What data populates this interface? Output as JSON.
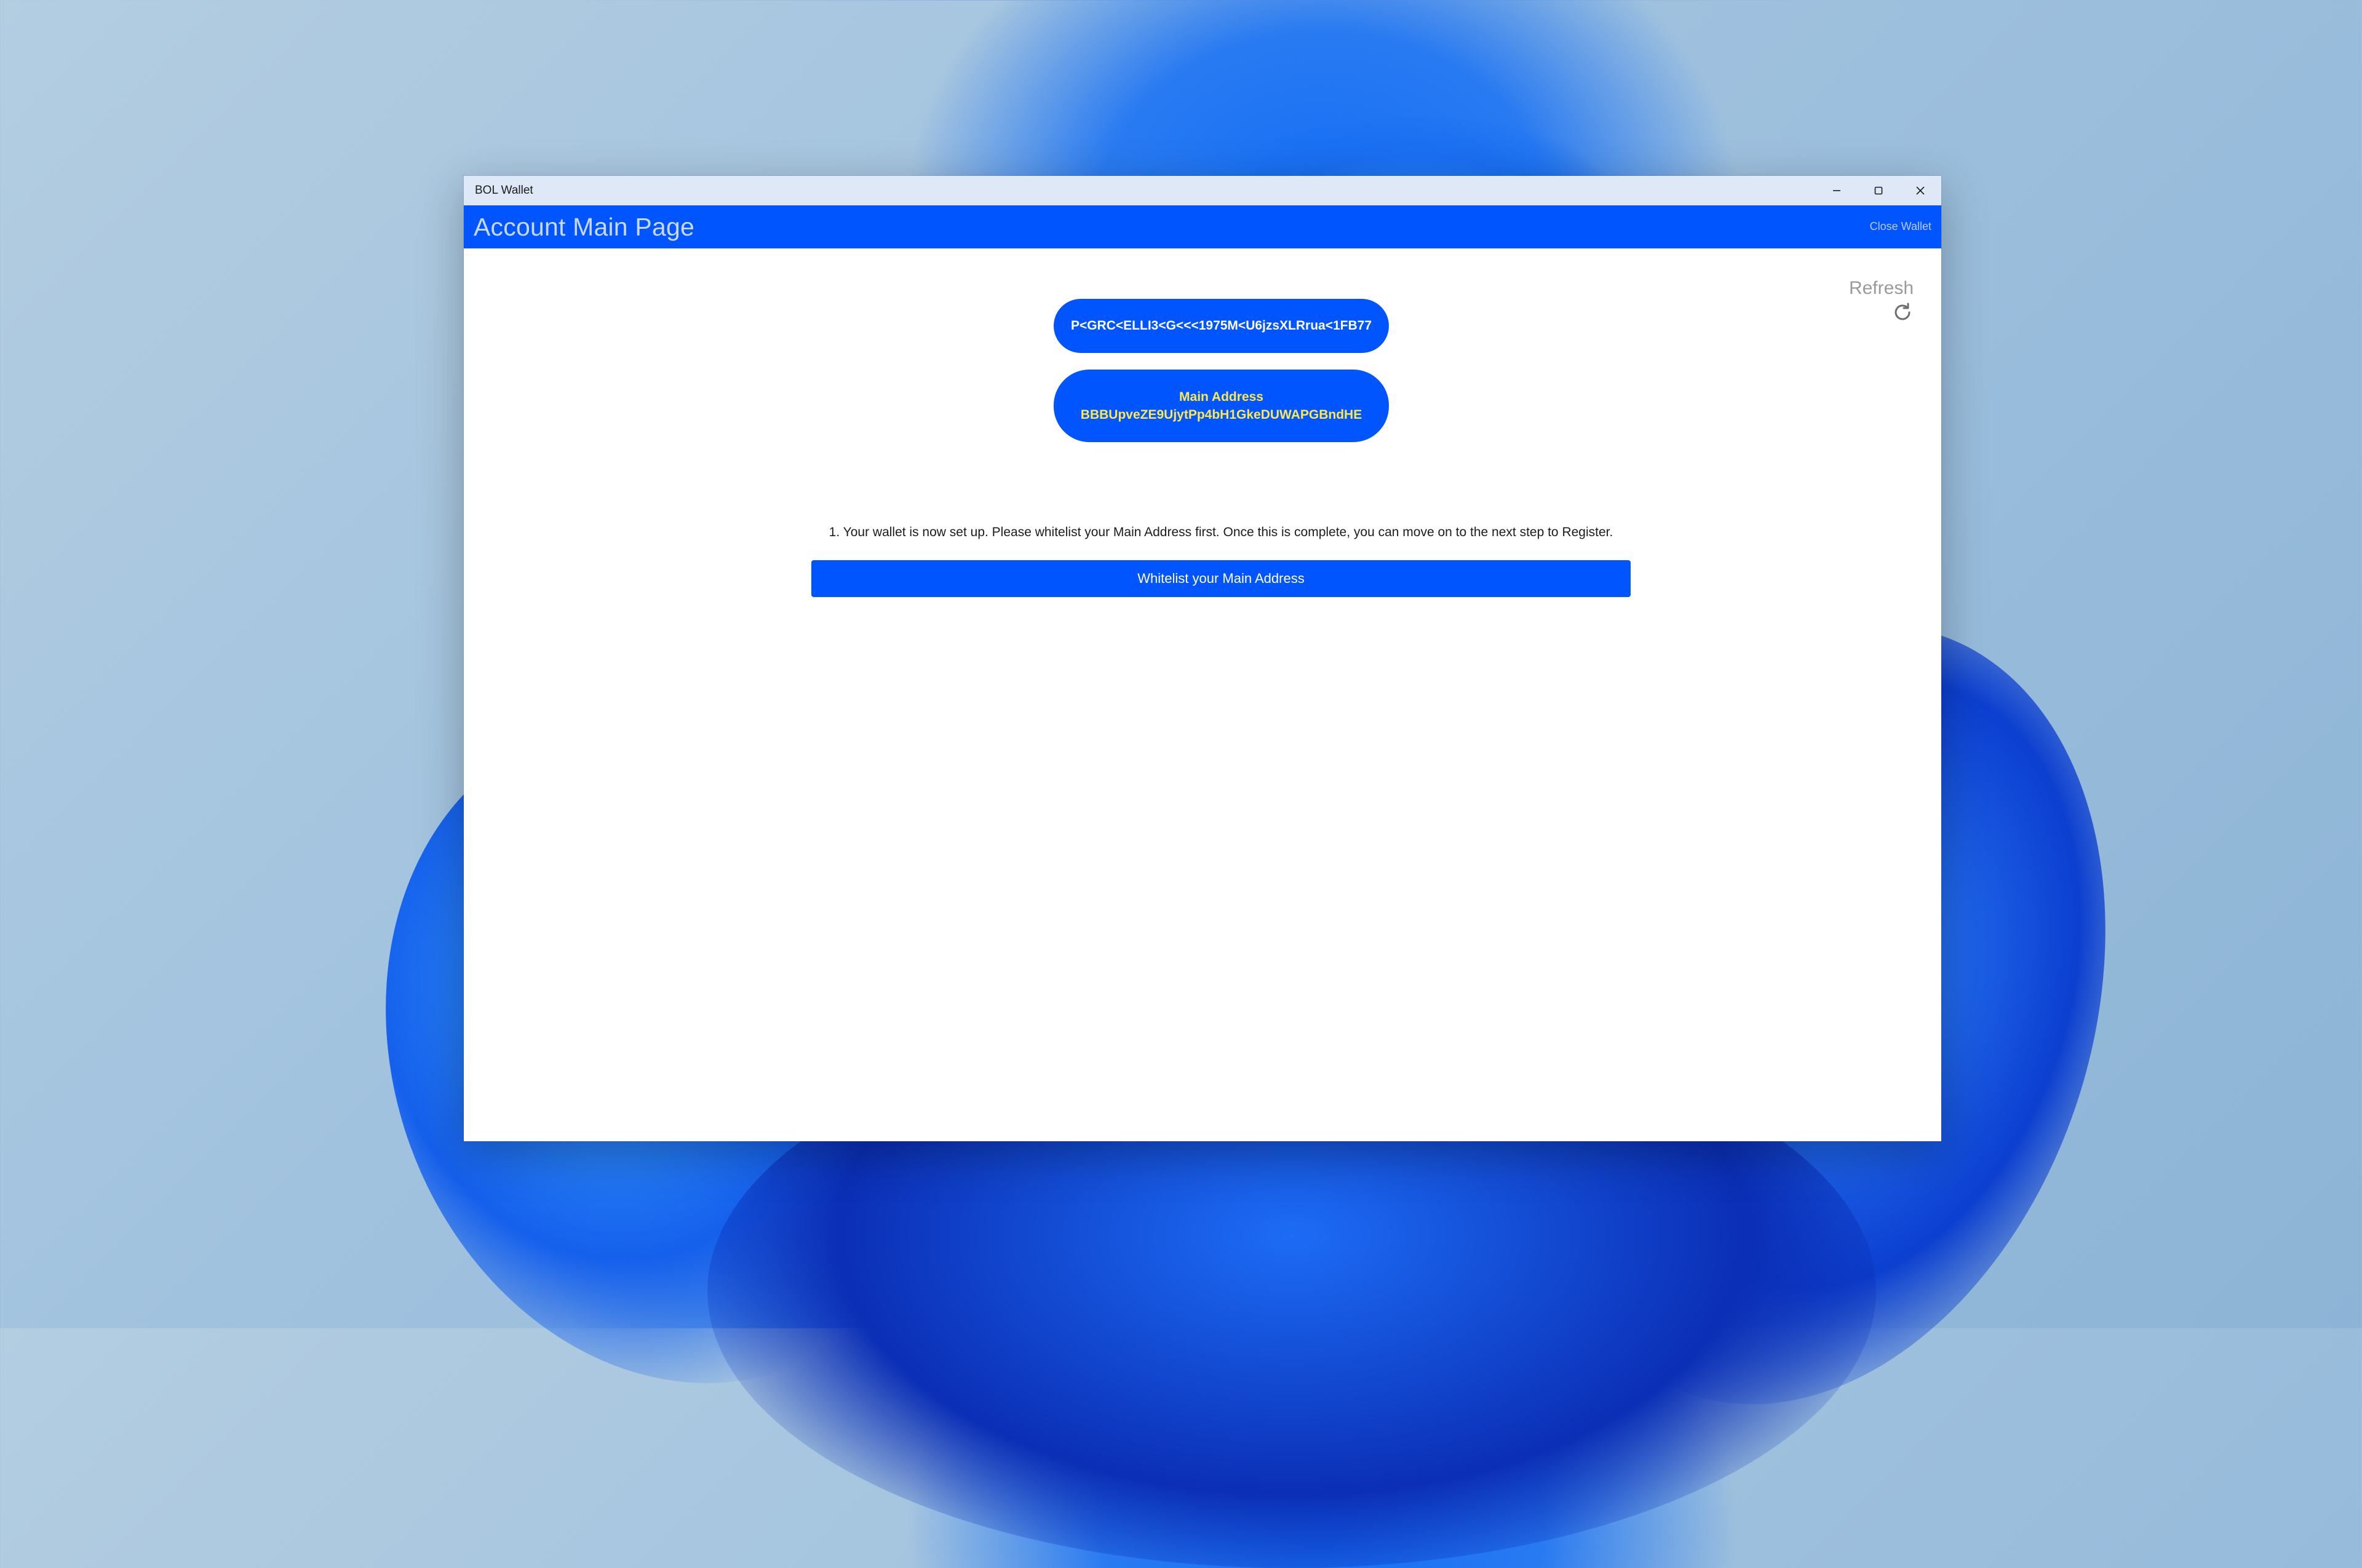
{
  "window": {
    "app_title": "BOL Wallet",
    "controls": {
      "minimize": "minimize-icon",
      "maximize": "maximize-icon",
      "close": "close-icon"
    }
  },
  "header": {
    "title": "Account Main Page",
    "close_wallet": "Close Wallet"
  },
  "refresh": {
    "label": "Refresh",
    "icon": "refresh-icon"
  },
  "identity": {
    "code": "P<GRC<ELLI3<G<<<1975M<U6jzsXLRrua<1FB77"
  },
  "main_address": {
    "label": "Main Address",
    "value": "BBBUpveZE9UjytPp4bH1GkeDUWAPGBndHE"
  },
  "setup": {
    "instruction": "1. Your wallet is now set up. Please whitelist your Main Address first. Once this is complete, you can move on to the next step to Register.",
    "button_label": "Whitelist your Main Address"
  },
  "colors": {
    "accent": "#0055fe",
    "address_text": "#ffe84a",
    "titlebar": "#dfe8f6"
  }
}
